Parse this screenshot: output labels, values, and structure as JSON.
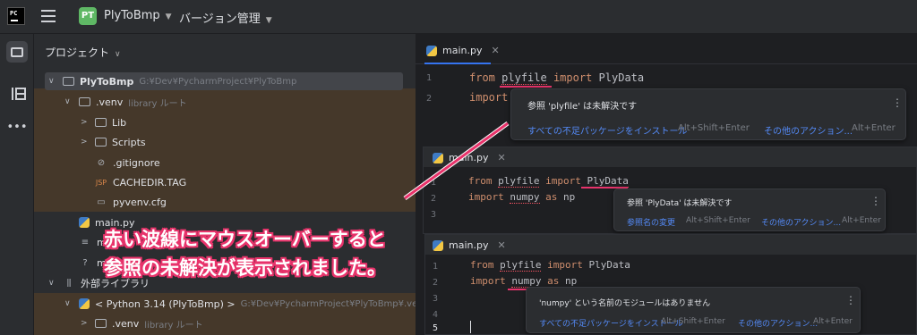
{
  "topbar": {
    "logo_text": "PC",
    "project_initials": "PT",
    "project_name": "PlyToBmp",
    "vcs_label": "バージョン管理"
  },
  "project_panel": {
    "title": "プロジェクト",
    "tree": [
      {
        "label": "PlyToBmp",
        "meta": "G:¥Dev¥PycharmProject¥PlyToBmp"
      },
      {
        "label": ".venv",
        "meta": "library ルート"
      },
      {
        "label": "Lib"
      },
      {
        "label": "Scripts"
      },
      {
        "label": ".gitignore"
      },
      {
        "label": "CACHEDIR.TAG",
        "icon_text": "JSP"
      },
      {
        "label": "pyvenv.cfg"
      },
      {
        "label": "main.py"
      },
      {
        "label": "m"
      },
      {
        "label": "m"
      },
      {
        "label": "外部ライブラリ"
      },
      {
        "label": "< Python 3.14 (PlyToBmp) >",
        "meta": "G:¥Dev¥PycharmProject¥PlyToBmp¥.venv¥S"
      },
      {
        "label": ".venv",
        "meta": "library ルート"
      }
    ]
  },
  "editor": {
    "tab_label": "main.py",
    "code_line1": {
      "from": "from",
      "module": "plyfile",
      "import": "import",
      "name": "PlyData"
    },
    "code_line2": {
      "import": "import",
      "module": "numpy",
      "as": "as",
      "alias": "np"
    },
    "popup1": {
      "message": "参照 'plyfile' は未解決です",
      "action1": "すべての不足パッケージをインストール",
      "key1": "Alt+Shift+Enter",
      "action2": "その他のアクション...",
      "key2": "Alt+Enter"
    },
    "popup2": {
      "message": "参照 'PlyData' は未解決です",
      "action1": "参照名の変更",
      "key1": "Alt+Shift+Enter",
      "action2": "その他のアクション...",
      "key2": "Alt+Enter"
    },
    "popup3": {
      "message": "'numpy' という名前のモジュールはありません",
      "action1": "すべての不足パッケージをインストール",
      "key1": "Alt+Shift+Enter",
      "action2": "その他のアクション...",
      "key2": "Alt+Enter"
    },
    "line_numbers": [
      "1",
      "2",
      "3",
      "4",
      "5"
    ]
  },
  "annotation": {
    "line1": "赤い波線にマウスオーバーすると",
    "line2": "参照の未解決が表示されました。",
    "color": "#e8336b"
  }
}
